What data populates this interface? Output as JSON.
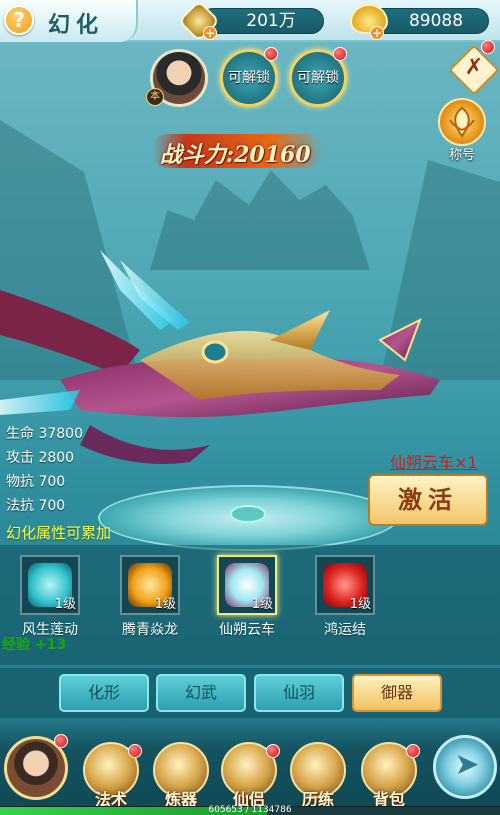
{
  "header": {
    "title": "幻化",
    "help_icon": "question-icon",
    "help_label": "?",
    "currency1": {
      "icon": "coin-icon",
      "value": "201万"
    },
    "currency2": {
      "icon": "ingot-icon",
      "value": "89088"
    }
  },
  "slots": {
    "avatar_badge": "本",
    "locked": [
      {
        "label": "可解锁"
      },
      {
        "label": "可解锁"
      }
    ]
  },
  "side": {
    "tool_icon": "tools-icon",
    "title_button_label": "称号"
  },
  "combat_power": "战斗力:20160",
  "stats": [
    "生命 37800",
    "攻击 2800",
    "物抗 700",
    "法抗 700"
  ],
  "selected_mount_name": "仙朔云车×1",
  "activate_label": "激活",
  "hint": "幻化属性可累加",
  "mounts": [
    {
      "name": "风生莲动",
      "level": "1级",
      "color": "#2fc0c8"
    },
    {
      "name": "腾青焱龙",
      "level": "1级",
      "color": "#f0a21a"
    },
    {
      "name": "仙朔云车",
      "level": "1级",
      "color": "#9fe8f2",
      "selected": true
    },
    {
      "name": "鸿运结",
      "level": "1级",
      "color": "#e0241f"
    }
  ],
  "exp_gain": "经验 +13",
  "tabs": [
    "化形",
    "幻武",
    "仙羽",
    "御器"
  ],
  "active_tab": "御器",
  "bottom_nav": [
    {
      "label": "法术",
      "icon": "spell-icon"
    },
    {
      "label": "炼器",
      "icon": "forge-icon"
    },
    {
      "label": "仙侣",
      "icon": "partner-icon"
    },
    {
      "label": "历练",
      "icon": "training-icon"
    },
    {
      "label": "背包",
      "icon": "bag-icon"
    }
  ],
  "exp_bar": {
    "text": "605653 / 1134786",
    "fraction": 0.534
  }
}
